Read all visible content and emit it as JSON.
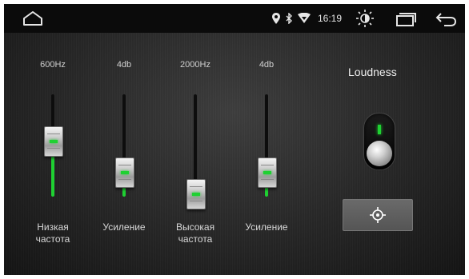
{
  "status_bar": {
    "home_icon": "home-icon",
    "location_icon": "location-icon",
    "bluetooth_icon": "bluetooth-icon",
    "wifi_icon": "wifi-icon",
    "time": "16:19",
    "brightness_icon": "brightness-icon",
    "recent_apps_icon": "recent-apps-icon",
    "back_icon": "back-icon"
  },
  "equalizer": {
    "bands": [
      {
        "value_label": "600Hz",
        "name": "Низкая частота",
        "level": 0.6
      },
      {
        "value_label": "4db",
        "name": "Усиление",
        "level": 0.25
      },
      {
        "value_label": "2000Hz",
        "name": "Высокая частота",
        "level": 0.0
      },
      {
        "value_label": "4db",
        "name": "Усиление",
        "level": 0.25
      }
    ]
  },
  "loudness": {
    "title": "Loudness",
    "enabled": false,
    "target_icon": "crosshair-icon"
  },
  "colors": {
    "accent": "#1fd132",
    "background": "#262626",
    "statusbar": "#0b0b0b"
  }
}
